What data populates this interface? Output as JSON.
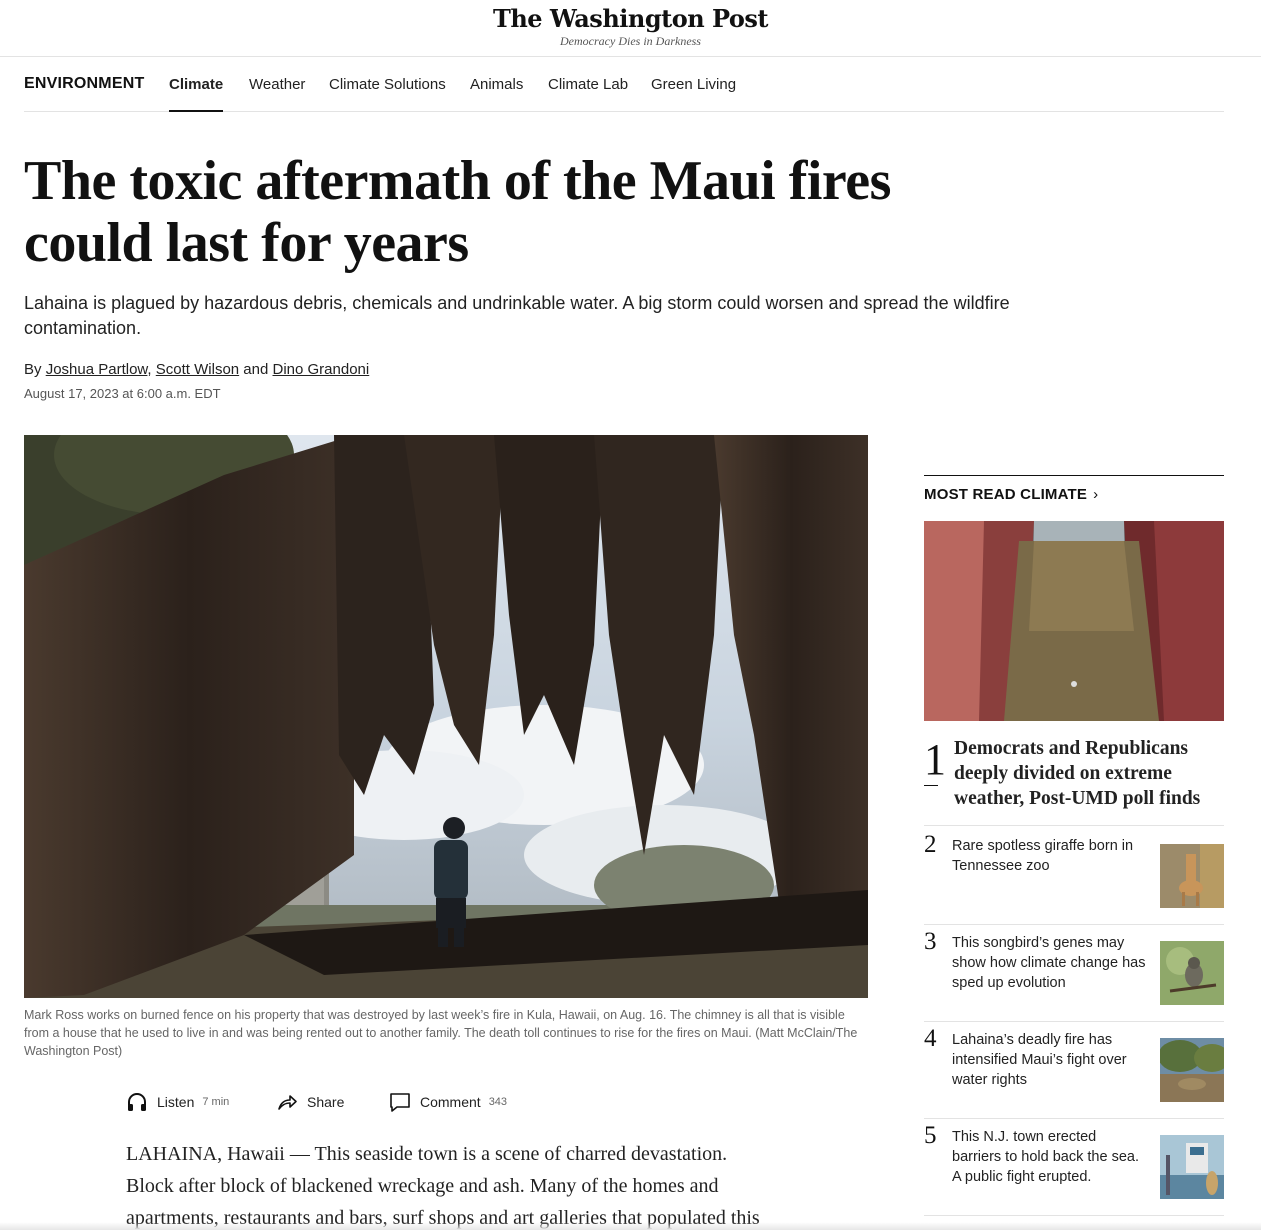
{
  "masthead": {
    "logo": "The Washington Post",
    "tagline": "Democracy Dies in Darkness"
  },
  "section_nav": {
    "title": "ENVIRONMENT",
    "items": [
      "Climate",
      "Weather",
      "Climate Solutions",
      "Animals",
      "Climate Lab",
      "Green Living"
    ],
    "active": "Climate"
  },
  "article": {
    "headline": "The toxic aftermath of the Maui fires could last for years",
    "dek": "Lahaina is plagued by hazardous debris, chemicals and undrinkable water. A big storm could worsen and spread the wildfire contamination.",
    "by": "By",
    "authors": [
      "Joshua Partlow",
      "Scott Wilson",
      "Dino Grandoni"
    ],
    "author_sep": ",",
    "author_and": "and",
    "date": "August 17, 2023 at 6:00 a.m. EDT",
    "caption": "Mark Ross works on burned fence on his property that was destroyed by last week’s fire in Kula, Hawaii, on Aug. 16. The chimney is all that is visible from a house that he used to live in and was being rented out to another family. The death toll continues to rise for the fires on Maui. (Matt McClain/The Washington Post)",
    "actions": {
      "listen_label": "Listen",
      "listen_meta": "7 min",
      "share_label": "Share",
      "comment_label": "Comment",
      "comment_meta": "343"
    },
    "body": "LAHAINA, Hawaii — This seaside town is a scene of charred devastation. Block after block of blackened wreckage and ash. Many of the homes and apartments, restaurants and bars, surf shops and art galleries that populated this"
  },
  "sidebar": {
    "title": "MOST READ CLIMATE",
    "chevron": "›",
    "items": [
      {
        "num": "1",
        "title": "Democrats and Republicans deeply divided on extreme weather, Post-UMD poll finds"
      },
      {
        "num": "2",
        "title": "Rare spotless giraffe born in Tennessee zoo"
      },
      {
        "num": "3",
        "title": "This songbird’s genes may show how climate change has sped up evolution"
      },
      {
        "num": "4",
        "title": "Lahaina’s deadly fire has intensified Maui’s fight over water rights"
      },
      {
        "num": "5",
        "title": "This N.J. town erected barriers to hold back the sea. A public fight erupted."
      }
    ]
  },
  "icons": {
    "listen": "headphones-icon",
    "share": "share-arrow-icon",
    "comment": "comment-bubble-icon",
    "chevron": "chevron-right-icon"
  }
}
